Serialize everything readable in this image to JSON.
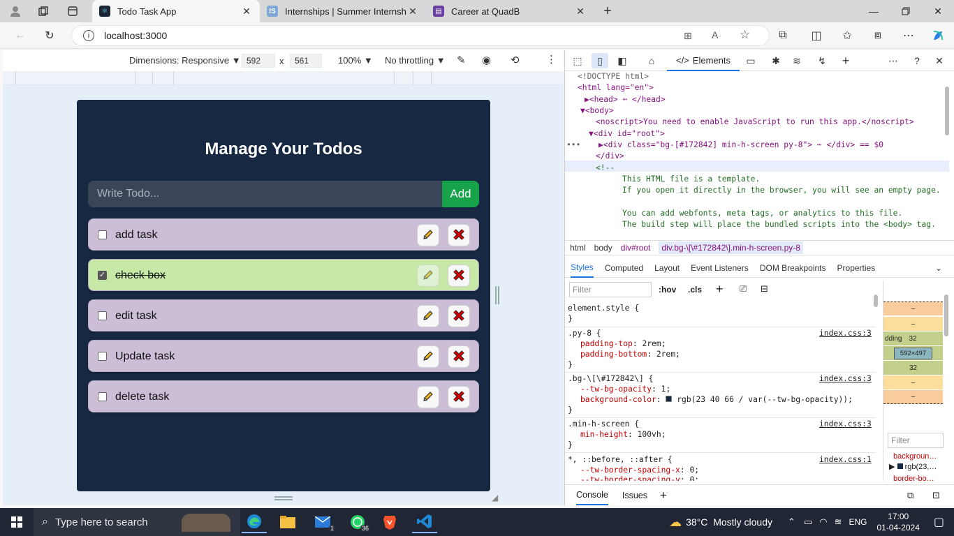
{
  "browser": {
    "tabs": [
      {
        "title": "Todo Task App",
        "active": true
      },
      {
        "title": "Internships | Summer Internship",
        "active": false
      },
      {
        "title": "Career at QuadB",
        "active": false
      }
    ],
    "url": "localhost:3000"
  },
  "device_toolbar": {
    "dimensions_label": "Dimensions: Responsive",
    "width": "592",
    "times": "x",
    "height": "561",
    "zoom": "100%",
    "throttling": "No throttling"
  },
  "app": {
    "heading": "Manage Your Todos",
    "input_placeholder": "Write Todo...",
    "add_label": "Add",
    "todos": [
      {
        "text": "add task",
        "completed": false
      },
      {
        "text": "check box",
        "completed": true
      },
      {
        "text": "edit task",
        "completed": false
      },
      {
        "text": "Update task",
        "completed": false
      },
      {
        "text": "delete task",
        "completed": false
      }
    ],
    "colors": {
      "background": "#172842",
      "item": "#ccbed7",
      "item_completed": "#c6e9a7",
      "add": "#16a34a",
      "delete": "#cc0000"
    }
  },
  "devtools": {
    "active_tab": "Elements",
    "dom_lines": [
      "<!DOCTYPE html>",
      "<html lang=\"en\">",
      "<head> ⋯ </head>",
      "<body>",
      "<noscript>You need to enable JavaScript to run this app.</noscript>",
      "<div id=\"root\">",
      "<div class=\"bg-[#172842] min-h-screen py-8\"> ⋯ </div> == $0",
      "</div>",
      "<!--",
      "This HTML file is a template.",
      "If you open it directly in the browser, you will see an empty page.",
      "You can add webfonts, meta tags, or analytics to this file.",
      "The build step will place the bundled scripts into the <body> tag."
    ],
    "breadcrumbs": [
      "html",
      "body",
      "div#root",
      "div.bg-\\[\\#172842\\].min-h-screen.py-8"
    ],
    "style_tabs": [
      "Styles",
      "Computed",
      "Layout",
      "Event Listeners",
      "DOM Breakpoints",
      "Properties"
    ],
    "filter_placeholder": "Filter",
    "hov": ":hov",
    "cls": ".cls",
    "rules": [
      {
        "selector": "element.style {",
        "source": "",
        "props": []
      },
      {
        "selector": ".py-8 {",
        "source": "index.css:3",
        "props": [
          [
            "padding-top",
            "2rem;"
          ],
          [
            "padding-bottom",
            "2rem;"
          ]
        ]
      },
      {
        "selector": ".bg-\\[\\#172842\\] {",
        "source": "index.css:3",
        "props": [
          [
            "--tw-bg-opacity",
            "1;"
          ],
          [
            "background-color",
            "rgb(23 40 66 / var(--tw-bg-opacity));"
          ]
        ]
      },
      {
        "selector": ".min-h-screen {",
        "source": "index.css:3",
        "props": [
          [
            "min-height",
            "100vh;"
          ]
        ]
      },
      {
        "selector": "*, ::before, ::after {",
        "source": "index.css:1",
        "props": [
          [
            "--tw-border-spacing-x",
            "0;"
          ],
          [
            "--tw-border-spacing-y",
            "0;"
          ]
        ]
      }
    ],
    "boxmodel": {
      "dash1": "–",
      "dash2": "–",
      "padding_label": "dding",
      "padding_top": "32",
      "content": "592×497",
      "padding_bottom": "32",
      "dash3": "–",
      "dash4": "–",
      "filter": "Filter",
      "prop1": "backgroun…",
      "prop1_val": "rgb(23,…",
      "prop2": "border-bo…"
    },
    "drawer_tabs": [
      "Console",
      "Issues"
    ]
  },
  "taskbar": {
    "search_placeholder": "Type here to search",
    "mail_badge": "1",
    "whatsapp_badge": "36",
    "weather": "38°C  Mostly cloudy",
    "lang": "ENG",
    "time": "17:00",
    "date": "01-04-2024"
  }
}
